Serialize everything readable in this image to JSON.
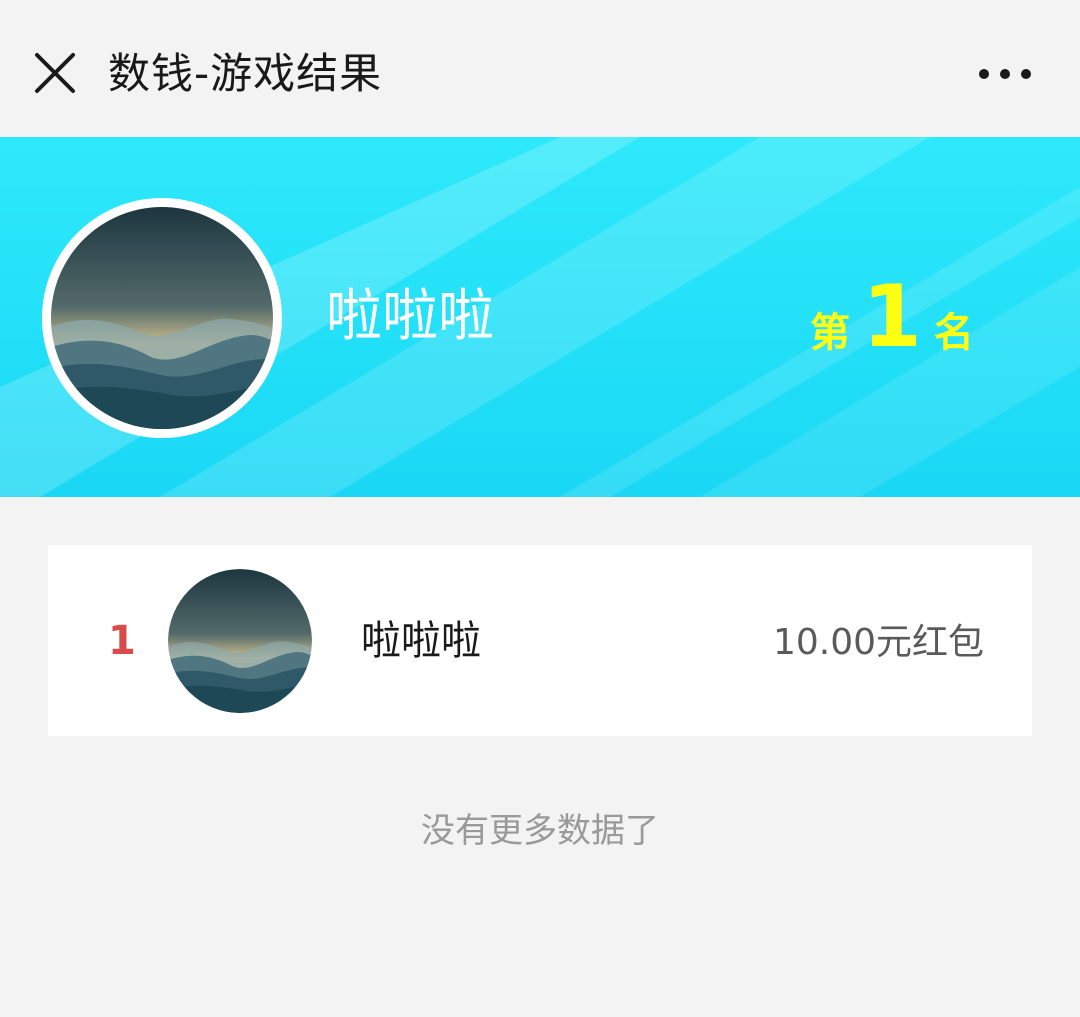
{
  "nav": {
    "title": "数钱-游戏结果",
    "close_icon": "close-icon",
    "more_icon": "more-dots-icon"
  },
  "banner": {
    "user_name": "啦啦啦",
    "rank_prefix": "第",
    "rank_number": "1",
    "rank_suffix": "名",
    "avatar_icon": "night-mountain-moon-avatar",
    "background_color": "#22e0f8",
    "rank_color": "#ffff14"
  },
  "results": [
    {
      "rank": "1",
      "name": "啦啦啦",
      "prize": "10.00元红包",
      "avatar_icon": "night-mountain-moon-avatar"
    }
  ],
  "rank_color": "#d94a4a",
  "footer": {
    "no_more_text": "没有更多数据了"
  }
}
